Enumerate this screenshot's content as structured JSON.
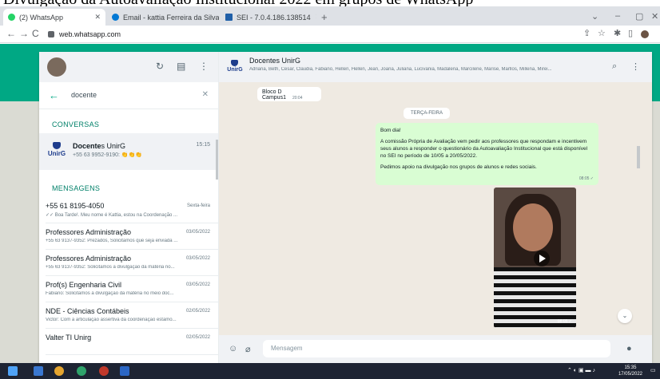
{
  "caption": "Divulgação da Autoavaliação Institucional 2022 em grupos de WhatsApp",
  "browser": {
    "tabs": [
      {
        "label": "(2) WhatsApp",
        "color": "#25d366"
      },
      {
        "label": "Email - kattia Ferreira da Silva - ...",
        "color": "#0078d4"
      },
      {
        "label": "SEI - 7.0.4.186.138514",
        "color": "#1f5fa8"
      }
    ],
    "url": "web.whatsapp.com"
  },
  "sidebar": {
    "search_value": "docente",
    "section_conversas": "CONVERSAS",
    "conversation": {
      "name_bold": "Docente",
      "name_rest": "s UnirG",
      "time": "15:15",
      "subtitle": "+55 63 9952-9190: 👏👏👏"
    },
    "section_mensagens": "MENSAGENS",
    "messages": [
      {
        "name": "+55 61 8195-4050",
        "time": "Sexta-feira",
        "preview": "✓✓ Boa Tarde!. Meu nome é Kattia, estou na Coordenação ..."
      },
      {
        "name": "Professores Administração",
        "time": "03/05/2022",
        "preview": "+55 63 9137-9352: Prezados, Solicitamos que seja enviada ..."
      },
      {
        "name": "Professores Administração",
        "time": "03/05/2022",
        "preview": "+55 63 9137-9352: Solicitamos a divulgação da matéria no..."
      },
      {
        "name": "Prof(s) Engenharia Civil",
        "time": "03/05/2022",
        "preview": "Fabiano: Solicitamos a divulgação da matéria no meio doc..."
      },
      {
        "name": "NDE - Ciências  Contábeis",
        "time": "02/05/2022",
        "preview": "Victor: Com a articulação assertiva da coordenação estamo..."
      },
      {
        "name": "Valter TI Unirg",
        "time": "02/05/2022",
        "preview": ""
      }
    ]
  },
  "chat": {
    "logo_text": "UnirG",
    "title": "Docentes UnirG",
    "members": "Adriana, Beth, Cesar, Claudia, Fabiano, Hellen, Hellen, Jean, Joana, Juliana, Lucivania, Madalena, Marcilene, Marise, Marllos, Millena, Mirei...",
    "incoming_text": "Bloco D Campus1",
    "incoming_time": "20:04",
    "day_label": "TERÇA-FEIRA",
    "outgoing": {
      "greeting": "Bom dia!",
      "body": "A comissão Própria de Avaliação vem pedir aos professores que respondam e incentivem seus alunos a responder o questionário da Autoavaliação Institucional que está disponível no SEI no período de 10/05 a 20/05/2022.",
      "closing": "Pedimos apoio na divulgação nos grupos de alunos e redes sociais.",
      "time": "08:05 ✓"
    },
    "video_time": "08:05 ✓",
    "composer_placeholder": "Mensagem"
  },
  "taskbar": {
    "time": "15:35",
    "date": "17/05/2022"
  }
}
